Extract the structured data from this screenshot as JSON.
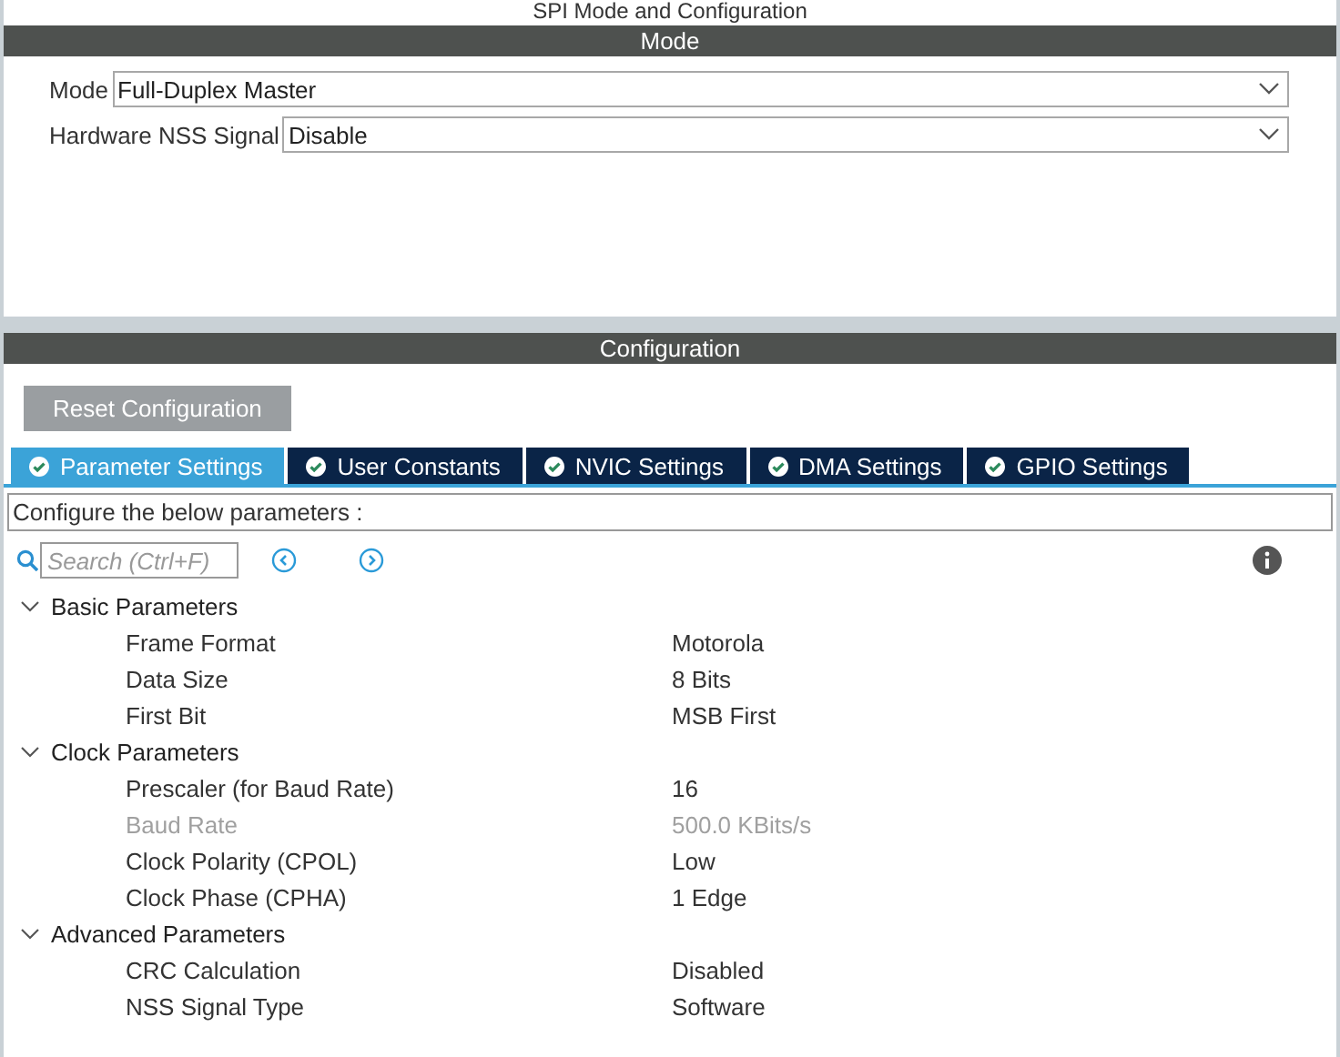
{
  "window": {
    "title": "SPI Mode and Configuration"
  },
  "mode": {
    "header": "Mode",
    "fields": [
      {
        "label": "Mode",
        "value": "Full-Duplex Master"
      },
      {
        "label": "Hardware NSS Signal",
        "value": "Disable"
      }
    ]
  },
  "configuration": {
    "header": "Configuration",
    "reset_button": "Reset Configuration",
    "tabs": [
      {
        "label": "Parameter Settings",
        "selected": true
      },
      {
        "label": "User Constants",
        "selected": false
      },
      {
        "label": "NVIC Settings",
        "selected": false
      },
      {
        "label": "DMA Settings",
        "selected": false
      },
      {
        "label": "GPIO Settings",
        "selected": false
      }
    ],
    "hint": "Configure the below parameters :",
    "search": {
      "placeholder": "Search (Ctrl+F)"
    },
    "tree": [
      {
        "label": "Basic Parameters",
        "expanded": true,
        "children": [
          {
            "label": "Frame Format",
            "value": "Motorola",
            "disabled": false
          },
          {
            "label": "Data Size",
            "value": "8 Bits",
            "disabled": false
          },
          {
            "label": "First Bit",
            "value": "MSB First",
            "disabled": false
          }
        ]
      },
      {
        "label": "Clock Parameters",
        "expanded": true,
        "children": [
          {
            "label": "Prescaler (for Baud Rate)",
            "value": "16",
            "disabled": false
          },
          {
            "label": "Baud Rate",
            "value": "500.0 KBits/s",
            "disabled": true
          },
          {
            "label": "Clock Polarity (CPOL)",
            "value": "Low",
            "disabled": false
          },
          {
            "label": "Clock Phase (CPHA)",
            "value": "1 Edge",
            "disabled": false
          }
        ]
      },
      {
        "label": "Advanced Parameters",
        "expanded": true,
        "children": [
          {
            "label": "CRC Calculation",
            "value": "Disabled",
            "disabled": false
          },
          {
            "label": "NSS Signal Type",
            "value": "Software",
            "disabled": false
          }
        ]
      }
    ]
  }
}
